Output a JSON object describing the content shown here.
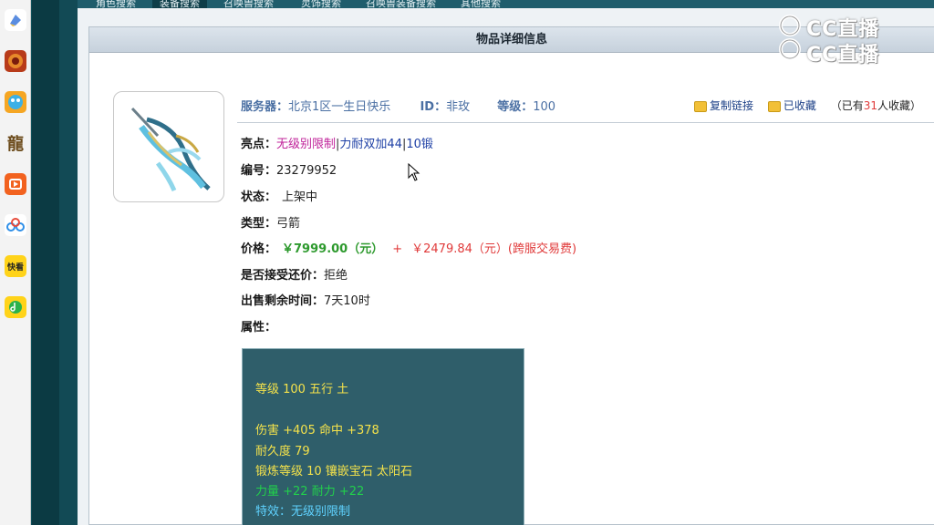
{
  "nav": {
    "tabs": [
      {
        "label": "角色搜索"
      },
      {
        "label": "装备搜索",
        "active": true
      },
      {
        "label": "召唤兽搜索"
      },
      {
        "label": "灵饰搜索"
      },
      {
        "label": "召唤兽装备搜索"
      },
      {
        "label": "其他搜索"
      }
    ]
  },
  "watermark": {
    "text_1": "CC直播",
    "text_2": "CC直播"
  },
  "panel": {
    "title": "物品详细信息"
  },
  "item": {
    "server_label": "服务器：",
    "server_value": "北京1区一生日快乐",
    "id_label": "ID：",
    "id_value": "非玫",
    "level_label": "等级：",
    "level_value": "100",
    "copy_link": "复制链接",
    "favorited": "已收藏",
    "fav_prefix": "（已有",
    "fav_count": "31",
    "fav_suffix": "人收藏）",
    "highlight_label": "亮点：",
    "highlight_1": "无级别限制",
    "highlight_sep_1": "|",
    "highlight_2": "力耐双加44",
    "highlight_sep_2": "|",
    "highlight_3": "10锻",
    "number_label": "编号：",
    "number_value": "23279952",
    "status_label": "状态：",
    "status_value": "上架中",
    "type_label": "类型：",
    "type_value": "弓箭",
    "price_label": "价格：",
    "price_value": "￥7999.00（元）",
    "price_plus": "+",
    "fee_value": "￥2479.84（元）(跨服交易费)",
    "counter_label": "是否接受还价：",
    "counter_value": "拒绝",
    "remaining_label": "出售剩余时间：",
    "remaining_value": "7天10时",
    "attr_label": "属性："
  },
  "stats": {
    "line_1": "等级 100 五行 土",
    "line_2": "伤害 +405 命中 +378",
    "line_3": "耐久度 79",
    "line_4": "锻炼等级 10 镶嵌宝石 太阳石",
    "line_5": "力量 +22 耐力 +22",
    "line_6": "特效：无级别限制"
  },
  "colors": {
    "stats_bg": "#2f5e6a",
    "stats_yellow": "#f4e24b",
    "stats_green": "#22d04b",
    "stats_cyan": "#5fd2ff",
    "price_green": "#2e9a2e",
    "fee_red": "#e03a3a",
    "highlight_pink": "#c0239a"
  }
}
